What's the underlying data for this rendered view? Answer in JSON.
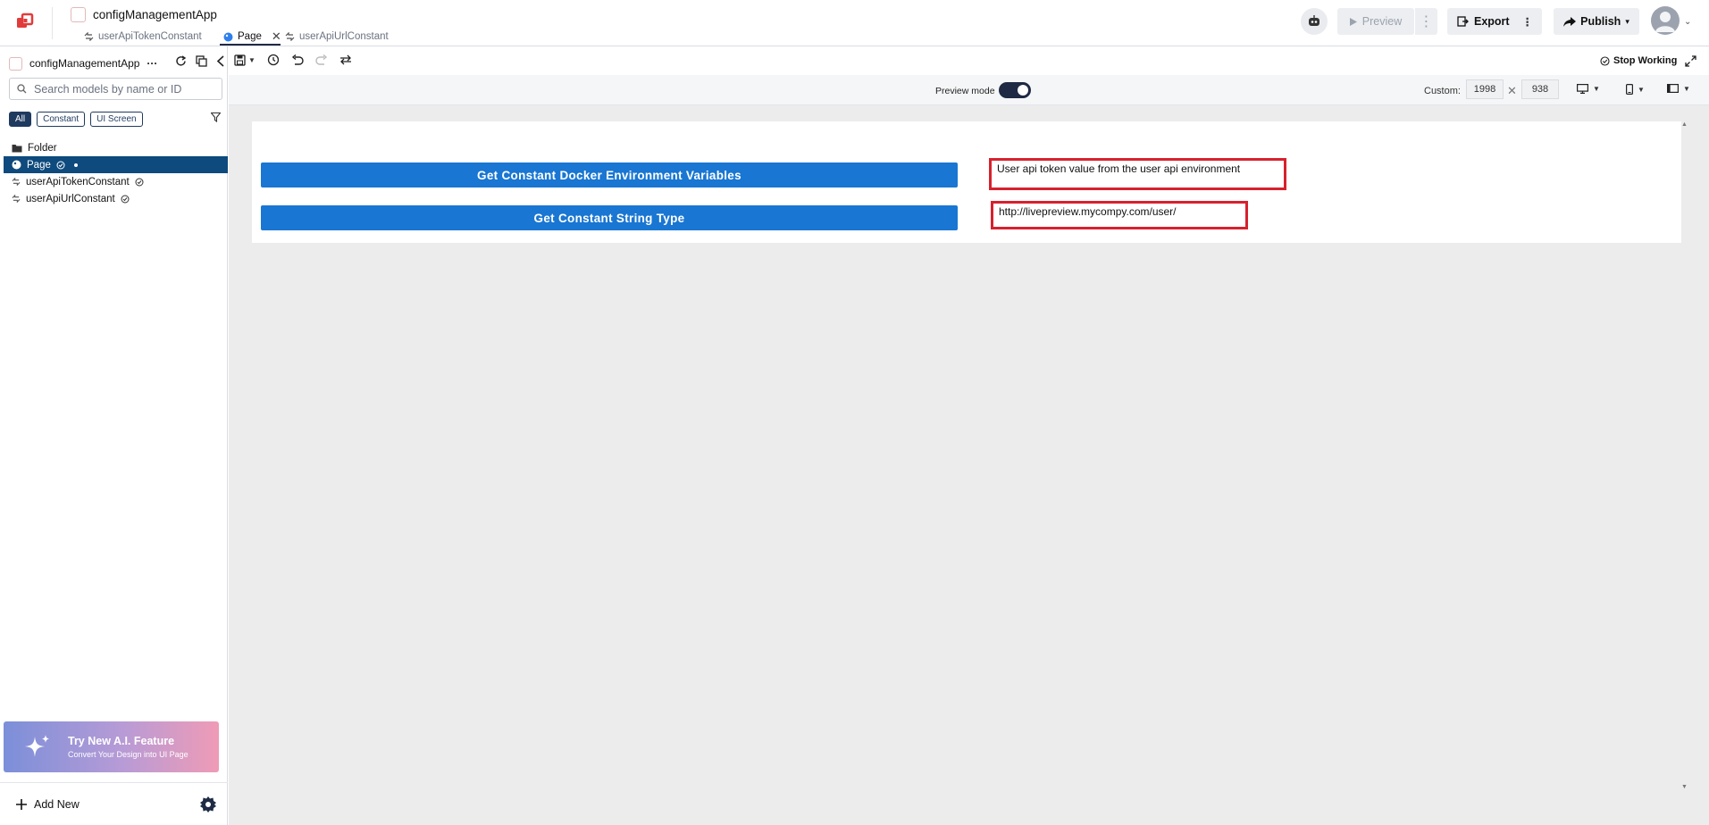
{
  "header": {
    "app_title": "configManagementApp",
    "tabs": [
      {
        "label": "userApiTokenConstant",
        "icon": "constant-icon",
        "active": false
      },
      {
        "label": "Page",
        "icon": "page-icon",
        "active": true
      },
      {
        "label": "userApiUrlConstant",
        "icon": "constant-icon",
        "active": false
      }
    ],
    "preview_label": "Preview",
    "export_label": "Export",
    "publish_label": "Publish"
  },
  "sidebar": {
    "project_name": "configManagementApp",
    "project_more": "···",
    "search_placeholder": "Search models by name or ID",
    "filters": [
      "All",
      "Constant",
      "UI Screen"
    ],
    "tree": [
      {
        "label": "Folder",
        "icon": "folder-icon"
      },
      {
        "label": "Page",
        "icon": "page-icon",
        "selected": true
      },
      {
        "label": "userApiTokenConstant",
        "icon": "constant-icon"
      },
      {
        "label": "userApiUrlConstant",
        "icon": "constant-icon"
      }
    ],
    "ai_banner": {
      "title": "Try New A.I. Feature",
      "subtitle": "Convert Your Design into UI Page"
    },
    "add_new_label": "Add New"
  },
  "toolbar": {
    "stop_working_label": "Stop Working",
    "preview_mode_label": "Preview mode",
    "preview_mode_on": true,
    "custom_label": "Custom:",
    "width_value": "1998",
    "height_value": "938"
  },
  "canvas": {
    "rows": [
      {
        "button_label": "Get Constant Docker Environment Variables",
        "result_text": "User api token value from the user api environment"
      },
      {
        "button_label": "Get Constant String Type",
        "result_text": "http://livepreview.mycompy.com/user/"
      }
    ]
  },
  "colors": {
    "accent": "#1976d2",
    "selected": "#0e4a7d",
    "highlight_border": "#d7212e",
    "dark": "#1f2a44"
  }
}
